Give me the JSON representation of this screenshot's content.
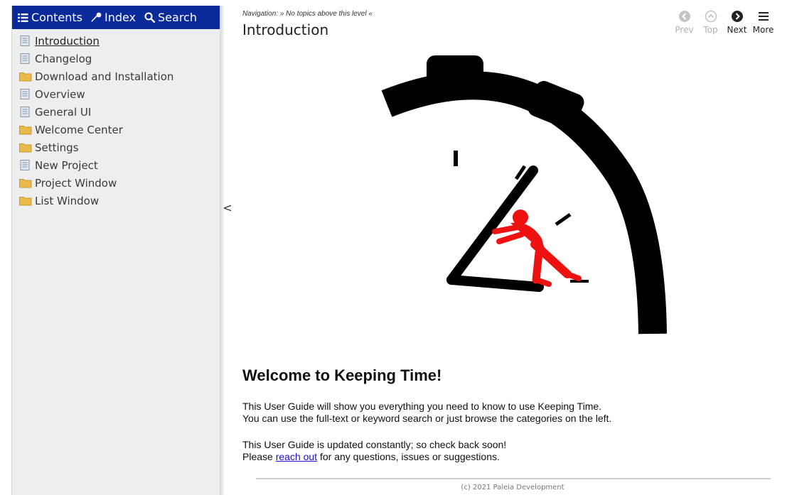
{
  "sidebar": {
    "tabs": [
      {
        "label": "Contents",
        "icon": "list-icon"
      },
      {
        "label": "Index",
        "icon": "key-icon"
      },
      {
        "label": "Search",
        "icon": "search-icon"
      }
    ],
    "items": [
      {
        "label": "Introduction",
        "icon": "page-icon",
        "active": true
      },
      {
        "label": "Changelog",
        "icon": "page-icon"
      },
      {
        "label": "Download and Installation",
        "icon": "folder-icon"
      },
      {
        "label": "Overview",
        "icon": "page-icon"
      },
      {
        "label": "General UI",
        "icon": "page-icon"
      },
      {
        "label": "Welcome Center",
        "icon": "folder-icon"
      },
      {
        "label": "Settings",
        "icon": "folder-icon"
      },
      {
        "label": "New Project",
        "icon": "page-icon"
      },
      {
        "label": "Project Window",
        "icon": "folder-icon"
      },
      {
        "label": "List Window",
        "icon": "folder-icon"
      }
    ],
    "collapse_glyph": "<"
  },
  "header": {
    "nav_prefix": "Navigation:",
    "nav_text": "» No topics above this level «",
    "title": "Introduction",
    "buttons": [
      {
        "label": "Prev",
        "icon": "circle-left-icon",
        "disabled": true
      },
      {
        "label": "Top",
        "icon": "circle-up-icon",
        "disabled": true
      },
      {
        "label": "Next",
        "icon": "circle-right-icon",
        "disabled": false
      },
      {
        "label": "More",
        "icon": "hamburger-icon",
        "disabled": false
      }
    ]
  },
  "content": {
    "heading": "Welcome to Keeping Time!",
    "para1_line1": "This User Guide will show you everything you need to know to use Keeping Time.",
    "para1_line2": "You can use the full-text or keyword search or just browse the categories on the left.",
    "para2_line1": "This User Guide is updated constantly; so check back soon!",
    "para2_before_link": "Please ",
    "para2_link": "reach out",
    "para2_after_link": " for any questions, issues or suggestions.",
    "footer": "(c) 2021 Paleia Development"
  },
  "colors": {
    "tabbar": "#0b2a9a",
    "sidebar_bg": "#eeeeee",
    "link": "#1a0dcc",
    "figure_red": "#ee1111",
    "folder": "#e9b94a"
  }
}
